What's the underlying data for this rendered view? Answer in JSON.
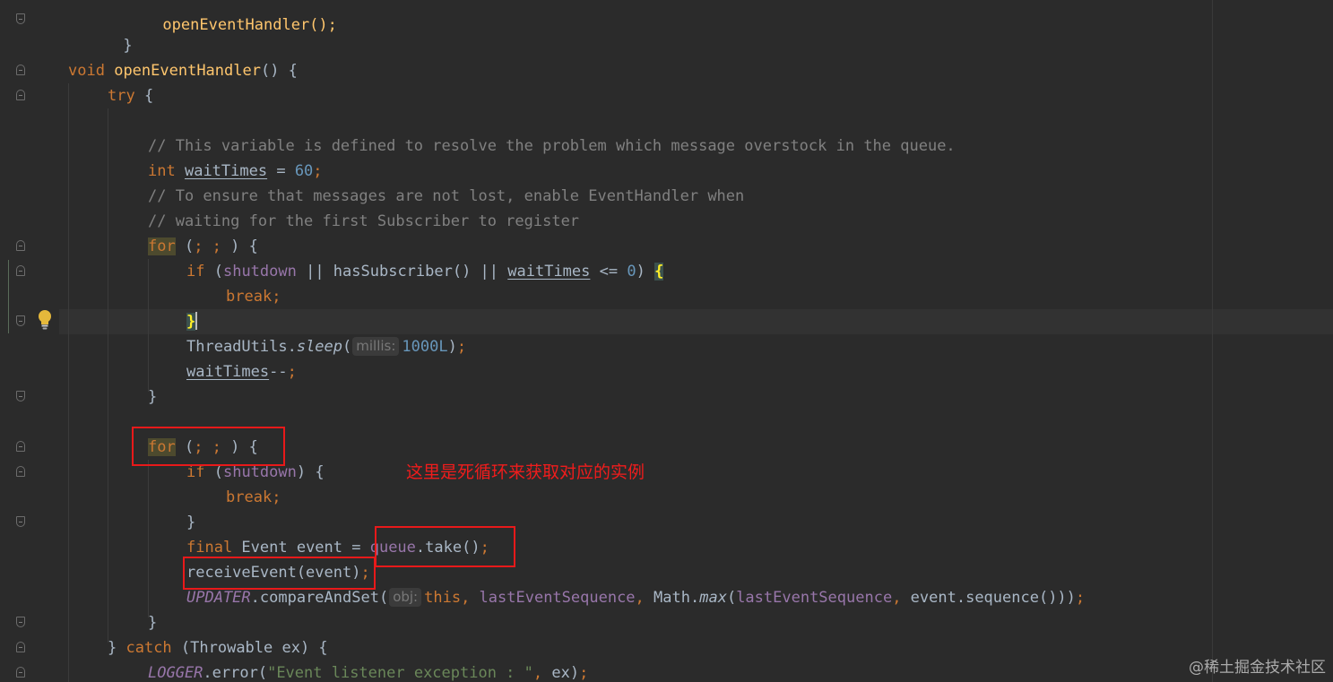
{
  "editor": {
    "language": "java",
    "theme_colors": {
      "background": "#2b2b2b",
      "keyword": "#cc7832",
      "method_declaration": "#ffc66d",
      "comment": "#808080",
      "number": "#6897bb",
      "field": "#9876aa",
      "string": "#6a8759",
      "default_text": "#a9b7c6",
      "annotation_box": "#e8191a"
    },
    "code": {
      "l01": "openEventHandler();",
      "l02": "}",
      "l03": {
        "kw": "void",
        "name": "openEventHandler",
        "rest": "() {"
      },
      "l04": {
        "kw": "try",
        "rest": " {"
      },
      "l05": "// This variable is defined to resolve the problem which message overstock in the queue.",
      "l06": {
        "kw": "int",
        "var": "waitTimes",
        "op": " = ",
        "num": "60",
        "semi": ";"
      },
      "l07": "// To ensure that messages are not lost, enable EventHandler when",
      "l08": "// waiting for the first Subscriber to register",
      "l09": {
        "kw": "for",
        "open": " (",
        "semis": "; ;",
        "close": " ) {"
      },
      "l10": {
        "kw": "if",
        "open": " (",
        "field": "shutdown",
        "mid": " || hasSubscriber() || ",
        "var": "waitTimes",
        "tail": " <= ",
        "num": "0",
        "close": ") ",
        "brace": "{"
      },
      "l11": {
        "kw": "break",
        "semi": ";"
      },
      "l12": {
        "brace": "}"
      },
      "l13": {
        "cls": "ThreadUtils.",
        "method": "sleep",
        "open": "(",
        "hint": "millis:",
        "num": "1000L",
        "close": ")",
        "semi": ";"
      },
      "l14": {
        "var": "waitTimes",
        "op": "--",
        "semi": ";"
      },
      "l15": "}",
      "l16": {
        "kw": "for",
        "open": " (",
        "semis": "; ;",
        "close": " ) {"
      },
      "l17": {
        "kw": "if",
        "open": " (",
        "field": "shutdown",
        "close": ") {"
      },
      "l18": {
        "kw": "break",
        "semi": ";"
      },
      "l19": "}",
      "l20": {
        "kw": "final",
        "decl": " Event event = ",
        "field": "queue",
        "call": ".take()",
        "semi": ";"
      },
      "l21": {
        "call": "receiveEvent(event)",
        "semi": ";"
      },
      "l22": {
        "field_it": "UPDATER",
        "call": ".compareAndSet(",
        "hint": "obj:",
        "kw": "this",
        "comma1": ", ",
        "field1": "lastEventSequence",
        "comma2": ", ",
        "cls": "Math.",
        "method": "max",
        "open": "(",
        "field2": "lastEventSequence",
        "comma3": ", ",
        "tail": "event.sequence()))",
        "semi": ";"
      },
      "l23": "}",
      "l24": {
        "pre": "} ",
        "kw": "catch",
        "rest": " (Throwable ex) {"
      },
      "l25": {
        "field_it": "LOGGER",
        "call": ".error(",
        "str": "\"Event listener exception : \"",
        "comma": ", ",
        "arg": "ex)",
        "semi": ";"
      }
    }
  },
  "annotation": {
    "text": "这里是死循环来获取对应的实例",
    "color": "#f01c1c"
  },
  "watermark": {
    "text": "@稀土掘金技术社区"
  },
  "gutter": {
    "intention_icon": "lightbulb-icon",
    "fold_icon": "fold-marker-icon"
  }
}
